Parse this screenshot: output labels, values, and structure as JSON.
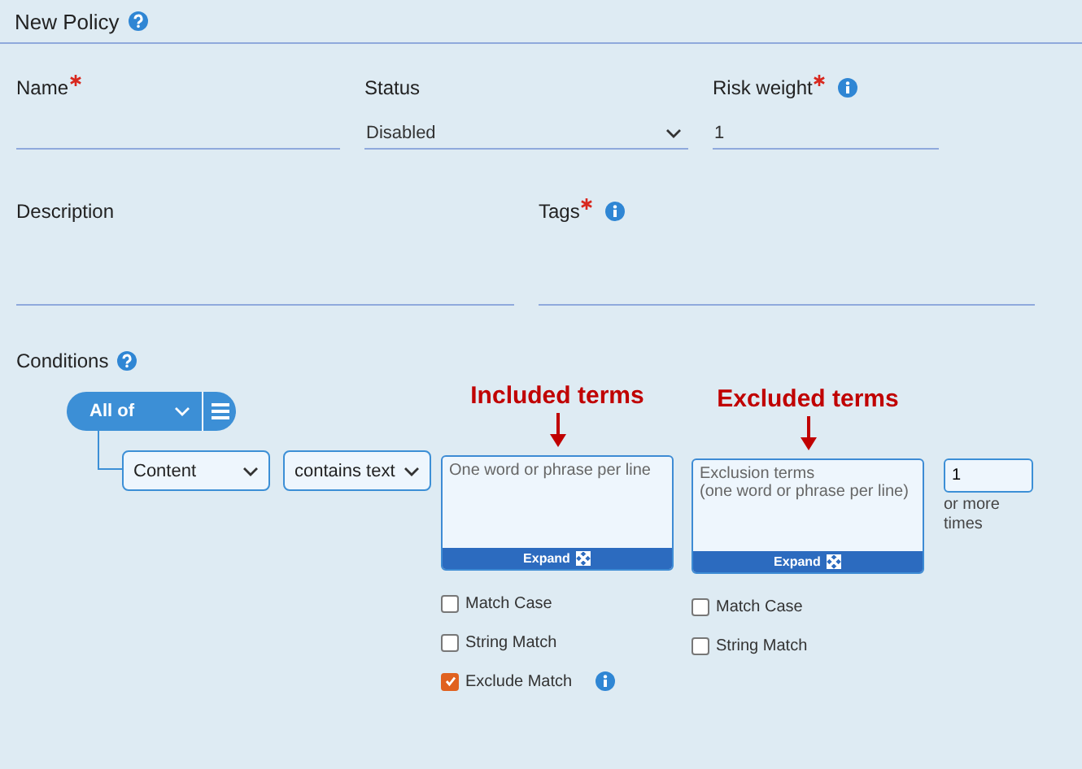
{
  "title": "New Policy",
  "fields": [
    {
      "label": "Name",
      "kind": "text",
      "required": true,
      "info": false
    },
    {
      "label": "Status",
      "kind": "select",
      "required": false,
      "info": false,
      "value": "Disabled"
    },
    {
      "label": "Risk weight",
      "kind": "text",
      "required": true,
      "info": true,
      "value": "1"
    },
    {
      "label": "Description",
      "kind": "text",
      "required": false,
      "info": false
    },
    {
      "label": "Tags",
      "kind": "text",
      "required": true,
      "info": true
    }
  ],
  "conditions": {
    "label": "Conditions",
    "group": "All of",
    "field": "Content",
    "operator": "contains text",
    "included": {
      "annotation": "Included terms",
      "placeholder": "One word or phrase per line",
      "expand": "Expand",
      "options": [
        {
          "label": "Match Case",
          "checked": false,
          "info": false
        },
        {
          "label": "String Match",
          "checked": false,
          "info": false
        },
        {
          "label": "Exclude Match",
          "checked": true,
          "info": true
        }
      ]
    },
    "excluded": {
      "annotation": "Excluded terms",
      "placeholder": "Exclusion terms\n(one word or phrase per line)",
      "expand": "Expand",
      "options": [
        {
          "label": "Match Case",
          "checked": false,
          "info": false
        },
        {
          "label": "String Match",
          "checked": false,
          "info": false
        }
      ]
    },
    "count": "1",
    "count_suffix": "or more times"
  }
}
